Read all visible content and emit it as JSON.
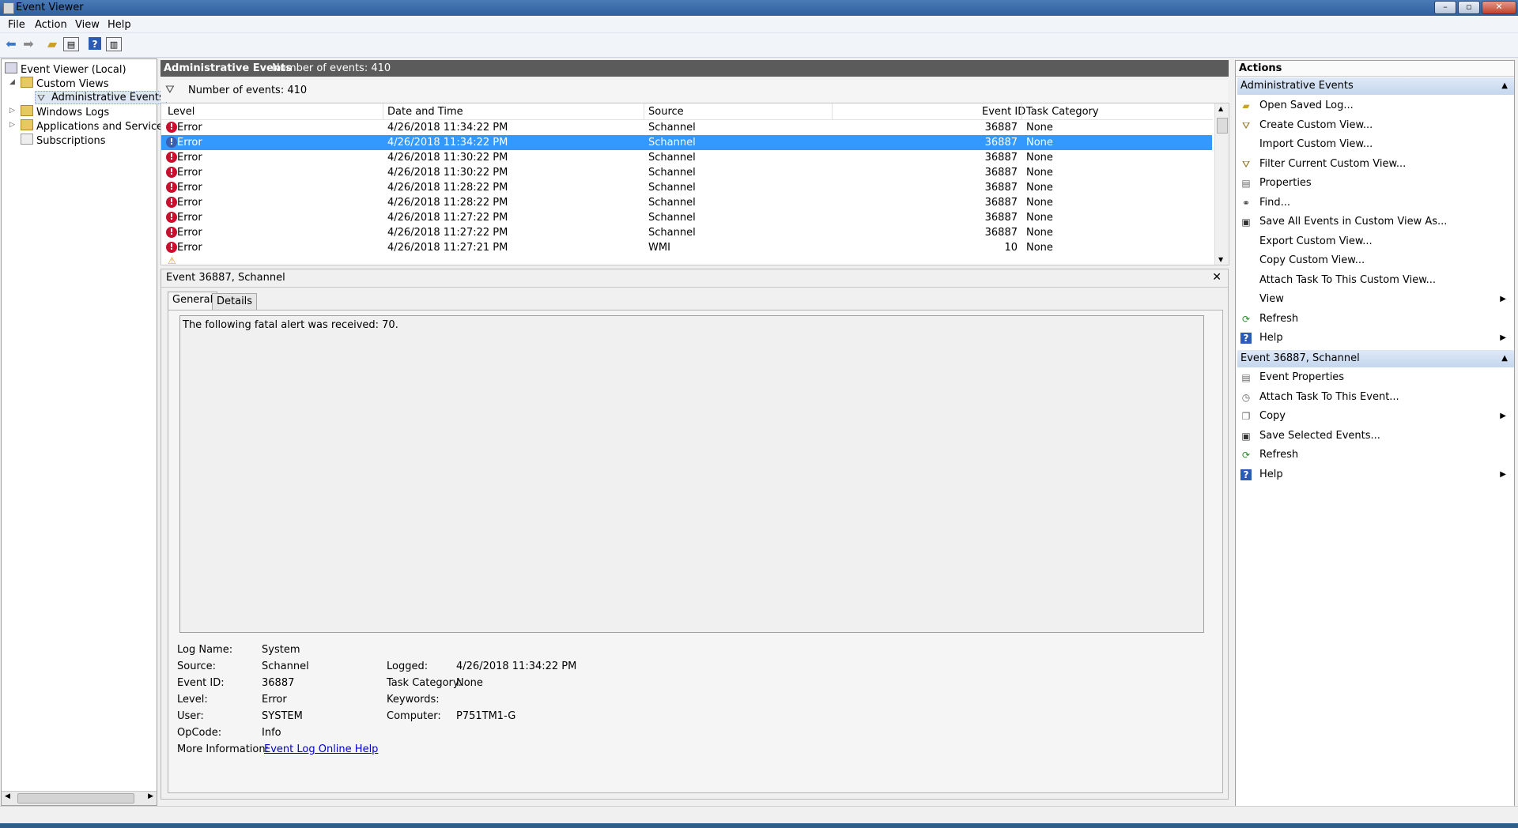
{
  "window": {
    "title": "Event Viewer"
  },
  "menu": [
    "File",
    "Action",
    "View",
    "Help"
  ],
  "tree": {
    "root": "Event Viewer (Local)",
    "custom_views": "Custom Views",
    "admin_events": "Administrative Events",
    "windows_logs": "Windows Logs",
    "apps_services": "Applications and Services Lo",
    "subscriptions": "Subscriptions"
  },
  "center": {
    "header_title": "Administrative Events",
    "header_count": "Number of events: 410",
    "filter_count": "Number of events: 410",
    "columns": [
      "Level",
      "Date and Time",
      "Source",
      "Event ID",
      "Task Category"
    ],
    "rows": [
      {
        "level": "Error",
        "datetime": "4/26/2018 11:34:22 PM",
        "source": "Schannel",
        "event_id": "36887",
        "category": "None",
        "selected": false
      },
      {
        "level": "Error",
        "datetime": "4/26/2018 11:34:22 PM",
        "source": "Schannel",
        "event_id": "36887",
        "category": "None",
        "selected": true
      },
      {
        "level": "Error",
        "datetime": "4/26/2018 11:30:22 PM",
        "source": "Schannel",
        "event_id": "36887",
        "category": "None",
        "selected": false
      },
      {
        "level": "Error",
        "datetime": "4/26/2018 11:30:22 PM",
        "source": "Schannel",
        "event_id": "36887",
        "category": "None",
        "selected": false
      },
      {
        "level": "Error",
        "datetime": "4/26/2018 11:28:22 PM",
        "source": "Schannel",
        "event_id": "36887",
        "category": "None",
        "selected": false
      },
      {
        "level": "Error",
        "datetime": "4/26/2018 11:28:22 PM",
        "source": "Schannel",
        "event_id": "36887",
        "category": "None",
        "selected": false
      },
      {
        "level": "Error",
        "datetime": "4/26/2018 11:27:22 PM",
        "source": "Schannel",
        "event_id": "36887",
        "category": "None",
        "selected": false
      },
      {
        "level": "Error",
        "datetime": "4/26/2018 11:27:22 PM",
        "source": "Schannel",
        "event_id": "36887",
        "category": "None",
        "selected": false
      },
      {
        "level": "Error",
        "datetime": "4/26/2018 11:27:21 PM",
        "source": "WMI",
        "event_id": "10",
        "category": "None",
        "selected": false
      }
    ]
  },
  "detail": {
    "title": "Event 36887, Schannel",
    "close": "✕",
    "tabs": [
      "General",
      "Details"
    ],
    "description": "The following fatal alert was received: 70.",
    "fields": {
      "log_name_label": "Log Name:",
      "log_name": "System",
      "source_label": "Source:",
      "source": "Schannel",
      "logged_label": "Logged:",
      "logged": "4/26/2018 11:34:22 PM",
      "event_id_label": "Event ID:",
      "event_id": "36887",
      "task_category_label": "Task Category:",
      "task_category": "None",
      "level_label": "Level:",
      "level": "Error",
      "keywords_label": "Keywords:",
      "keywords": "",
      "user_label": "User:",
      "user": "SYSTEM",
      "computer_label": "Computer:",
      "computer": "P751TM1-G",
      "opcode_label": "OpCode:",
      "opcode": "Info",
      "more_info_label": "More Information:",
      "more_info_link": "Event Log Online Help"
    }
  },
  "actions": {
    "title": "Actions",
    "section1": "Administrative Events",
    "items1": [
      {
        "label": "Open Saved Log...",
        "icon": "folder-icon",
        "arrow": false
      },
      {
        "label": "Create Custom View...",
        "icon": "funnel-icon",
        "arrow": false
      },
      {
        "label": "Import Custom View...",
        "icon": "",
        "arrow": false
      },
      {
        "label": "Filter Current Custom View...",
        "icon": "funnel-icon",
        "arrow": false
      },
      {
        "label": "Properties",
        "icon": "properties-icon",
        "arrow": false
      },
      {
        "label": "Find...",
        "icon": "binoculars-icon",
        "arrow": false
      },
      {
        "label": "Save All Events in Custom View As...",
        "icon": "save-icon",
        "arrow": false
      },
      {
        "label": "Export Custom View...",
        "icon": "",
        "arrow": false
      },
      {
        "label": "Copy Custom View...",
        "icon": "",
        "arrow": false
      },
      {
        "label": "Attach Task To This Custom View...",
        "icon": "",
        "arrow": false
      },
      {
        "label": "View",
        "icon": "",
        "arrow": true
      },
      {
        "label": "Refresh",
        "icon": "refresh-icon",
        "arrow": false
      },
      {
        "label": "Help",
        "icon": "help-icon",
        "arrow": true
      }
    ],
    "section2": "Event 36887, Schannel",
    "items2": [
      {
        "label": "Event Properties",
        "icon": "properties-icon",
        "arrow": false
      },
      {
        "label": "Attach Task To This Event...",
        "icon": "task-icon",
        "arrow": false
      },
      {
        "label": "Copy",
        "icon": "copy-icon",
        "arrow": true
      },
      {
        "label": "Save Selected Events...",
        "icon": "save-icon",
        "arrow": false
      },
      {
        "label": "Refresh",
        "icon": "refresh-icon",
        "arrow": false
      },
      {
        "label": "Help",
        "icon": "help-icon",
        "arrow": true
      }
    ]
  },
  "colors": {
    "selection": "#3399ff",
    "error": "#c8102e",
    "section": "#c4d6ee"
  }
}
